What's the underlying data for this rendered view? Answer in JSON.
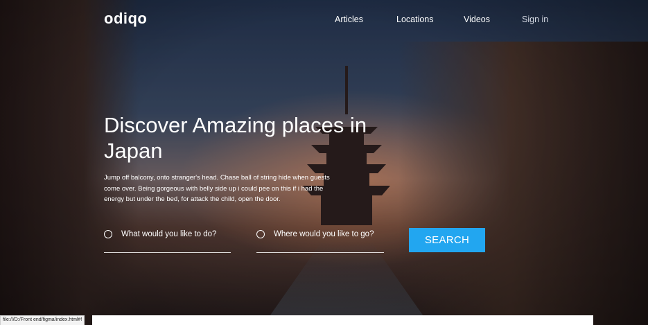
{
  "header": {
    "logo": "odiqo",
    "nav": [
      {
        "label": "Articles"
      },
      {
        "label": "Locations"
      },
      {
        "label": "Videos"
      },
      {
        "label": "Sign in"
      }
    ]
  },
  "hero": {
    "headline": "Discover Amazing places in Japan",
    "description": "Jump off balcony, onto stranger's head. Chase ball of string hide when guests come over. Being gorgeous with belly side up i could pee on this if i had the energy but under the bed, for attack the child, open the door."
  },
  "search": {
    "what_placeholder": "What would you like to do?",
    "where_placeholder": "Where would you like to go?",
    "button_label": "SEARCH"
  },
  "status_bar": {
    "url": "file:///D:/Front end/figma/index.html#!"
  },
  "colors": {
    "accent": "#22a6f0",
    "text": "#ffffff"
  },
  "icons": {
    "radio": "radio-circle-icon"
  }
}
